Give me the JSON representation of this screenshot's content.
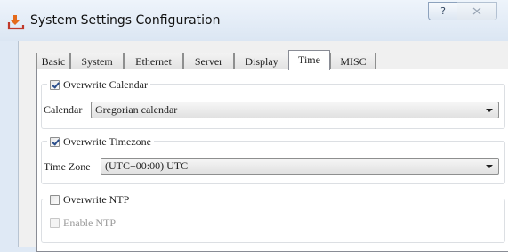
{
  "window": {
    "title": "System Settings Configuration",
    "help_label": "?",
    "close_label": "☒"
  },
  "tabs": [
    {
      "label": "Basic"
    },
    {
      "label": "System"
    },
    {
      "label": "Ethernet"
    },
    {
      "label": "Server"
    },
    {
      "label": "Display"
    },
    {
      "label": "Time"
    },
    {
      "label": "MISC"
    }
  ],
  "active_tab": "Time",
  "calendar_group": {
    "checkbox_label": "Overwrite Calendar",
    "checked": true,
    "field_label": "Calendar",
    "value": "Gregorian calendar"
  },
  "timezone_group": {
    "checkbox_label": "Overwrite Timezone",
    "checked": true,
    "field_label": "Time Zone",
    "value": "(UTC+00:00) UTC"
  },
  "ntp_group": {
    "checkbox_label": "Overwrite NTP",
    "checked": false,
    "enable_label": "Enable NTP",
    "enable_checked": false,
    "enable_disabled": true
  },
  "colors": {
    "accent": "#2a4e8c",
    "window_bg": "#f0f0f0",
    "titlebar": "#dbe6f3"
  }
}
